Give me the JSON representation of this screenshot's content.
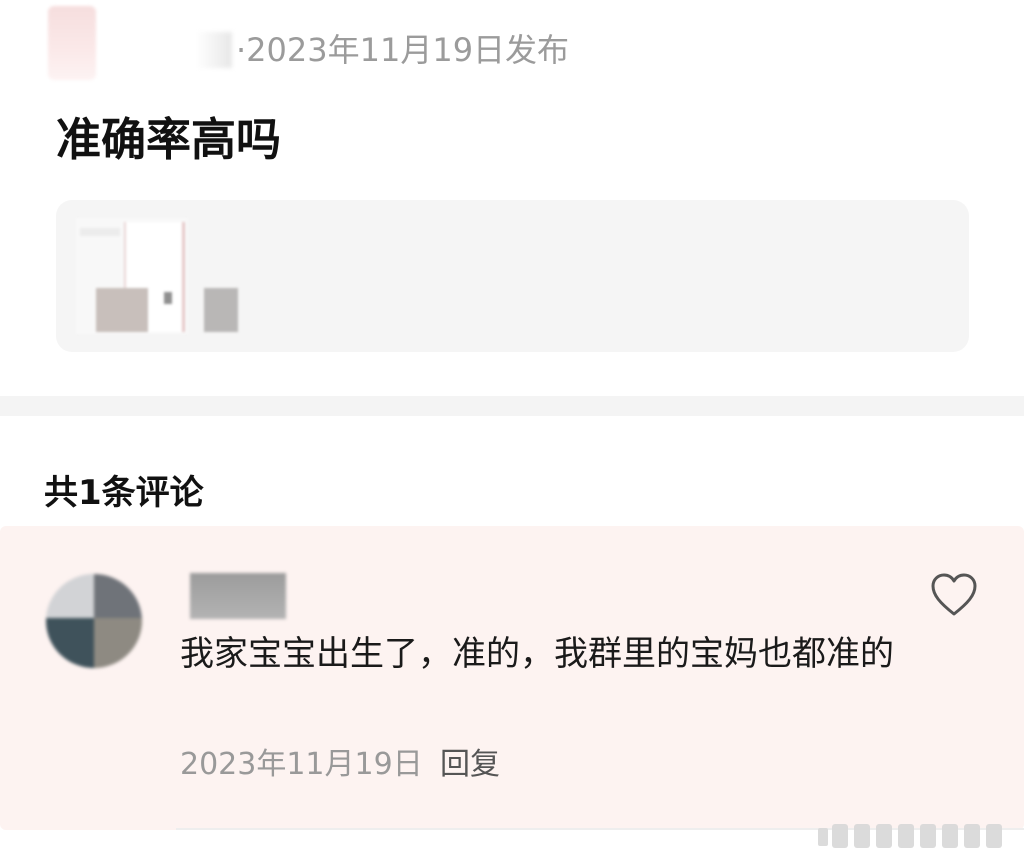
{
  "post": {
    "meta": "·2023年11月19日发布",
    "title": "准确率高吗"
  },
  "comments": {
    "header": "共1条评论",
    "items": [
      {
        "text": "我家宝宝出生了，准的，我群里的宝妈也都准的",
        "date": "2023年11月19日",
        "reply_label": "回复",
        "like_icon": "heart-outline-icon"
      }
    ]
  },
  "colors": {
    "meta_text": "#9b9b9b",
    "comment_bg": "#fdf3f1",
    "icon_stroke": "#555555"
  }
}
